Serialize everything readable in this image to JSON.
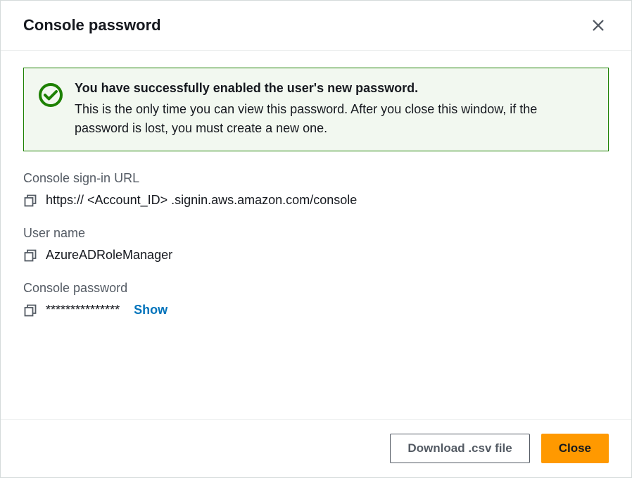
{
  "header": {
    "title": "Console password"
  },
  "alert": {
    "title": "You have successfully enabled the user's new password.",
    "description": "This is the only time you can view this password. After you close this window, if the password is lost, you must create a new one."
  },
  "fields": {
    "signin_url": {
      "label": "Console sign-in URL",
      "value": "https:// <Account_ID> .signin.aws.amazon.com/console"
    },
    "username": {
      "label": "User name",
      "value": "AzureADRoleManager"
    },
    "password": {
      "label": "Console password",
      "value": "***************",
      "show_label": "Show"
    }
  },
  "footer": {
    "download_label": "Download .csv file",
    "close_label": "Close"
  }
}
